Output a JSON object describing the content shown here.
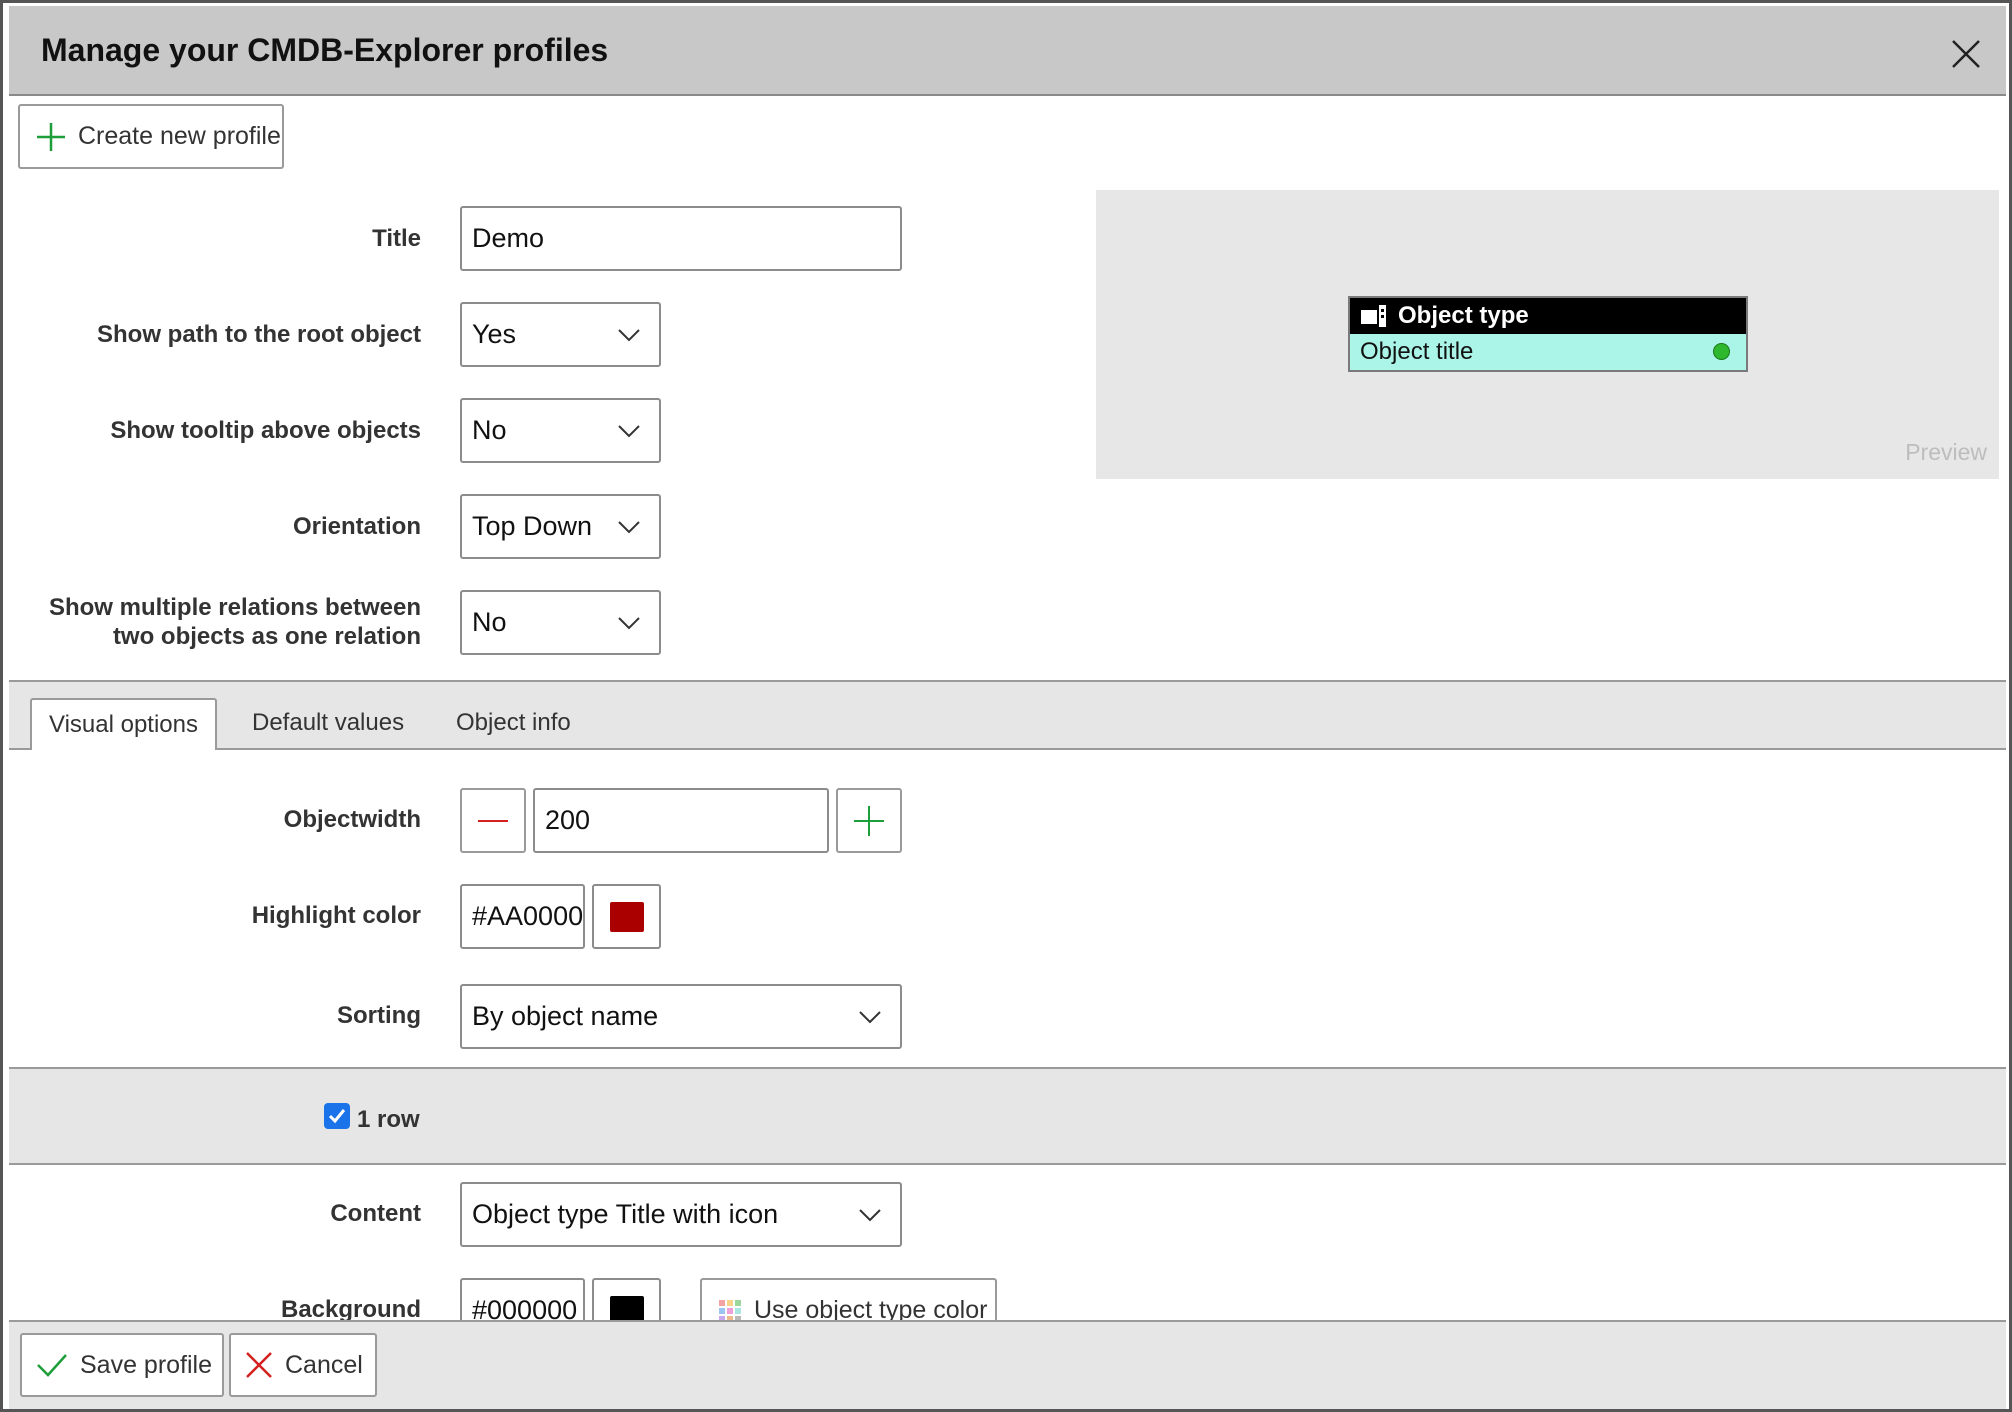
{
  "dialog": {
    "title": "Manage your CMDB-Explorer profiles"
  },
  "toolbar": {
    "create_label": "Create new profile"
  },
  "form": {
    "title_label": "Title",
    "title_value": "Demo",
    "path_label": "Show path to the root object",
    "path_value": "Yes",
    "tooltip_label": "Show tooltip above objects",
    "tooltip_value": "No",
    "orientation_label": "Orientation",
    "orientation_value": "Top Down",
    "multi_label_line1": "Show multiple relations between",
    "multi_label_line2": "two objects as one relation",
    "multi_value": "No"
  },
  "preview": {
    "object_type": "Object type",
    "object_title": "Object title",
    "watermark": "Preview"
  },
  "tabs": [
    {
      "label": "Visual options",
      "active": true
    },
    {
      "label": "Default values",
      "active": false
    },
    {
      "label": "Object info",
      "active": false
    }
  ],
  "visual": {
    "width_label": "Objectwidth",
    "width_value": "200",
    "highlight_label": "Highlight color",
    "highlight_value": "#AA0000",
    "highlight_color": "#aa0000",
    "sorting_label": "Sorting",
    "sorting_value": "By object name"
  },
  "row": {
    "label": "1 row",
    "checked": true
  },
  "content": {
    "content_label": "Content",
    "content_value": "Object type Title with icon",
    "background_label": "Background",
    "background_value": "#000000",
    "background_color": "#000000",
    "use_type_color_label": "Use object type color"
  },
  "footer": {
    "save_label": "Save profile",
    "cancel_label": "Cancel"
  },
  "colors": {
    "accent_green": "#1e9e3a",
    "danger_red": "#d42020",
    "status_green": "#2db82d"
  }
}
